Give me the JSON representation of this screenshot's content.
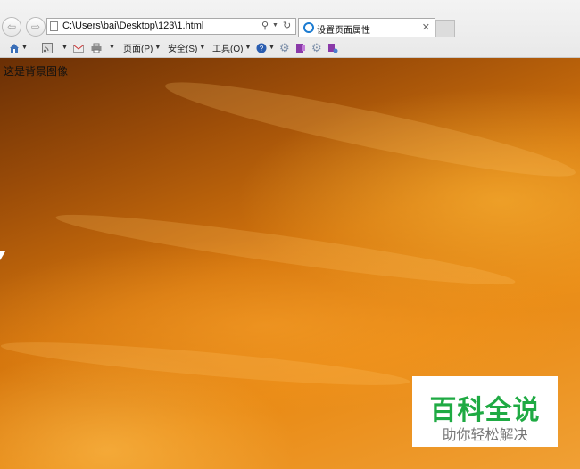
{
  "browser": {
    "address_url": "C:\\Users\\bai\\Desktop\\123\\1.html",
    "tab_title": "设置页面属性",
    "tab_close": "✕",
    "menus": {
      "page": "页面(P)",
      "safety": "安全(S)",
      "tools": "工具(O)"
    }
  },
  "page": {
    "background_text": "这是背景图像"
  },
  "watermark": {
    "title": "百科全说",
    "subtitle": "助你轻松解决"
  }
}
